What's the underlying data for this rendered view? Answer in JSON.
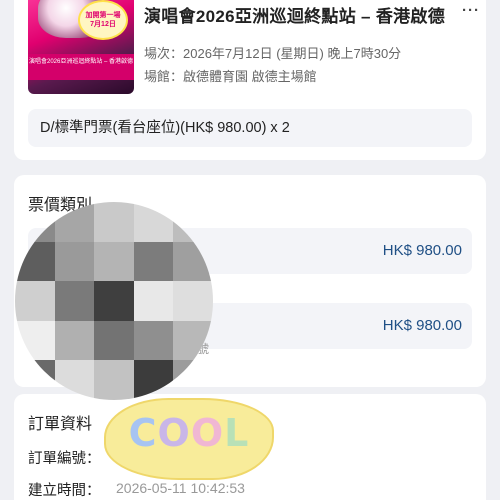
{
  "event": {
    "poster_lines": [
      "加開第一場",
      "7月12日"
    ],
    "poster_banner": "演唱會2026亞洲巡迴終點站 – 香港啟德",
    "title": "演唱會2026亞洲巡迴終點站 – 香港啟德",
    "more_label": "···",
    "date_line": "場次：2026年7月12日 (星期日) 晚上7時30分",
    "venue_line": "場館：啟德體育園 啟德主場館",
    "ticket_line": "D/標準門票(看台座位)(HK$ 980.00) x 2"
  },
  "price_section": {
    "title": "票價類別",
    "rows": [
      {
        "price": "HK$ 980.00"
      },
      {
        "price": "HK$ 980.00"
      }
    ],
    "faded_label": "號"
  },
  "order_section": {
    "title": "訂單資料",
    "order_no_label": "訂單編號：",
    "created_label": "建立時間：",
    "created_value": "2026-05-11 10:42:53"
  },
  "sticker": {
    "text_c": "C",
    "text_o1": "O",
    "text_o2": "O",
    "text_l": "L"
  },
  "colors": {
    "page_bg": "#eff0f4",
    "price_text": "#1f4f85"
  }
}
